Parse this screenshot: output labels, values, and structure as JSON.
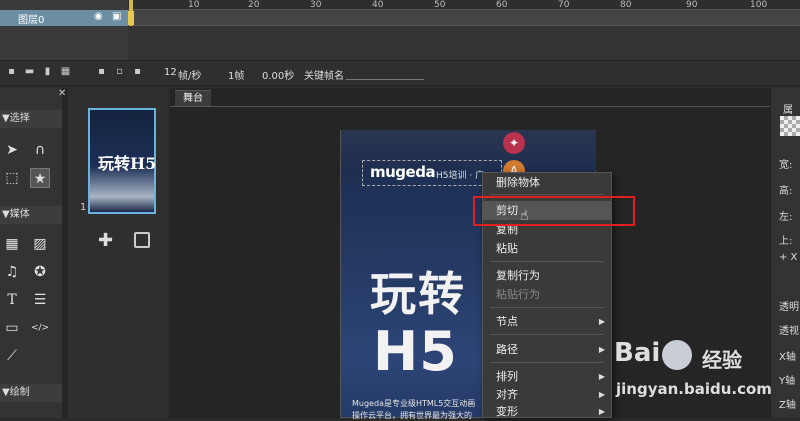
{
  "timeline": {
    "ruler_ticks": [
      "10",
      "20",
      "30",
      "40",
      "50",
      "60",
      "70",
      "80",
      "90",
      "100"
    ],
    "layer_name": "图层0"
  },
  "frame_bar": {
    "fps": "12",
    "fps_label": "帧/秒",
    "frame_count": "1帧",
    "time": "0.00秒",
    "keyframe_name_label": "关键帧名"
  },
  "tool_panel": {
    "sections": [
      "选择",
      "媒体",
      "绘制"
    ]
  },
  "page_panel": {
    "thumb_text": "玩转H5",
    "page_number": "1"
  },
  "stage": {
    "tab_label": "舞台",
    "logo_text": "mugeda",
    "banner_text": "H5培训 · 广",
    "headline_cn": "玩转",
    "headline_h5": "H5",
    "desc_line1": "Mugeda是专业级HTML5交互动画",
    "desc_line2": "操作云平台，拥有世界最为强大的"
  },
  "context_menu": {
    "items": [
      {
        "label": "删除物体",
        "disabled": false
      },
      {
        "label": "剪切",
        "disabled": false
      },
      {
        "label": "复制",
        "disabled": false
      },
      {
        "label": "粘贴",
        "disabled": false
      },
      {
        "label": "复制行为",
        "disabled": false
      },
      {
        "label": "粘贴行为",
        "disabled": true
      },
      {
        "label": "节点",
        "disabled": false
      },
      {
        "label": "路径",
        "disabled": false
      },
      {
        "label": "排列",
        "disabled": false
      },
      {
        "label": "对齐",
        "disabled": false
      },
      {
        "label": "变形",
        "disabled": false
      }
    ]
  },
  "properties": {
    "title": "属性",
    "labels": [
      "宽:",
      "高:",
      "左:",
      "上:",
      "+ X",
      "透明",
      "透视",
      "X轴",
      "Y轴",
      "Z轴"
    ]
  },
  "watermark": {
    "brand": "Bai",
    "product": "经验",
    "url": "jingyan.baidu.com"
  },
  "colors": {
    "highlight": "#e02020",
    "layer_selected": "#6c8ea3",
    "thumb_border": "#6ab3e0"
  }
}
